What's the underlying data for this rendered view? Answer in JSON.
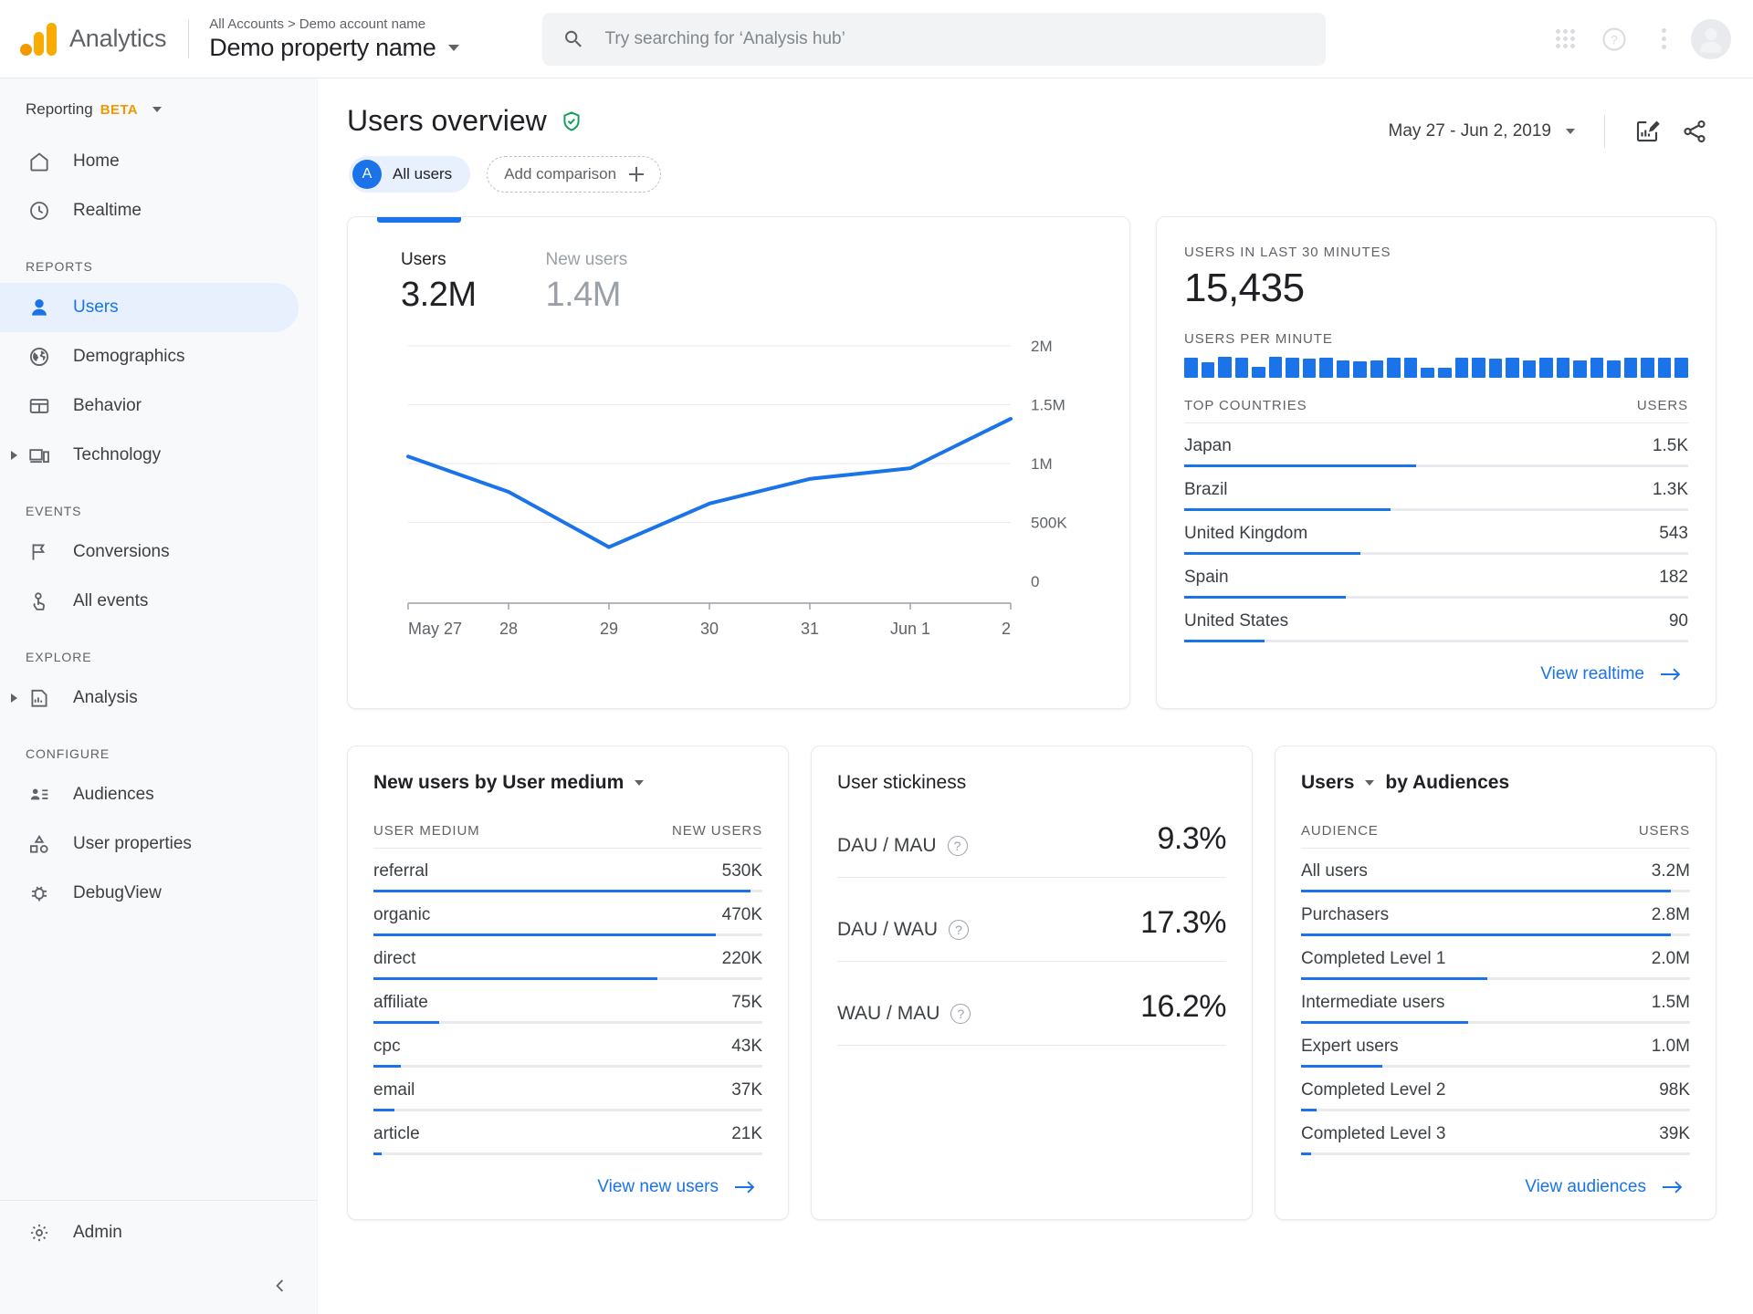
{
  "topbar": {
    "brand_name": "Analytics",
    "breadcrumb_root": "All Accounts",
    "breadcrumb_sep": ">",
    "breadcrumb_account": "Demo account name",
    "property_title": "Demo property name",
    "search_placeholder": "Try searching for ‘Analysis hub’",
    "icons": {
      "search": "search-icon",
      "apps": "apps-grid-icon",
      "help": "help-circle-icon",
      "more": "kebab-menu-icon",
      "avatar": "user-avatar"
    }
  },
  "sidebar": {
    "reporting_label": "Reporting",
    "reporting_beta": "BETA",
    "primary": [
      {
        "label": "Home",
        "icon": "home-icon"
      },
      {
        "label": "Realtime",
        "icon": "clock-icon"
      }
    ],
    "sections": [
      {
        "title": "REPORTS",
        "items": [
          {
            "label": "Users",
            "icon": "person-icon",
            "active": true,
            "expandable": false
          },
          {
            "label": "Demographics",
            "icon": "globe-icon",
            "active": false,
            "expandable": false
          },
          {
            "label": "Behavior",
            "icon": "window-icon",
            "active": false,
            "expandable": false
          },
          {
            "label": "Technology",
            "icon": "devices-icon",
            "active": false,
            "expandable": true
          }
        ]
      },
      {
        "title": "EVENTS",
        "items": [
          {
            "label": "Conversions",
            "icon": "flag-icon",
            "active": false,
            "expandable": false
          },
          {
            "label": "All events",
            "icon": "tap-icon",
            "active": false,
            "expandable": false
          }
        ]
      },
      {
        "title": "EXPLORE",
        "items": [
          {
            "label": "Analysis",
            "icon": "analysis-icon",
            "active": false,
            "expandable": true
          }
        ]
      },
      {
        "title": "CONFIGURE",
        "items": [
          {
            "label": "Audiences",
            "icon": "audiences-icon",
            "active": false,
            "expandable": false
          },
          {
            "label": "User properties",
            "icon": "shapes-icon",
            "active": false,
            "expandable": false
          },
          {
            "label": "DebugView",
            "icon": "bug-icon",
            "active": false,
            "expandable": false
          }
        ]
      }
    ],
    "admin_label": "Admin",
    "admin_icon": "gear-icon",
    "collapse_icon": "chevron-left-icon"
  },
  "page": {
    "title": "Users overview",
    "verified_icon": "shield-check-icon",
    "chip_all_users": {
      "avatar_letter": "A",
      "label": "All users"
    },
    "chip_add_comparison": "Add comparison",
    "date_range": "May 27 - Jun 2, 2019",
    "insights_icon": "insights-edit-icon",
    "share_icon": "share-icon"
  },
  "users_card": {
    "metrics": [
      {
        "label": "Users",
        "value": "3.2M"
      },
      {
        "label": "New users",
        "value": "1.4M"
      }
    ]
  },
  "realtime_card": {
    "last30_label": "USERS IN LAST 30 MINUTES",
    "last30_value": "15,435",
    "per_minute_label": "USERS PER MINUTE",
    "table_head": {
      "dimension": "TOP COUNTRIES",
      "metric": "USERS"
    },
    "rows": [
      {
        "name": "Japan",
        "value": "1.5K",
        "pct": 46
      },
      {
        "name": "Brazil",
        "value": "1.3K",
        "pct": 41
      },
      {
        "name": "United Kingdom",
        "value": "543",
        "pct": 35
      },
      {
        "name": "Spain",
        "value": "182",
        "pct": 32
      },
      {
        "name": "United States",
        "value": "90",
        "pct": 16
      }
    ],
    "link": "View realtime",
    "link_icon": "arrow-right-icon"
  },
  "new_users_card": {
    "title": "New users  by User medium",
    "table_head": {
      "dimension": "USER MEDIUM",
      "metric": "NEW USERS"
    },
    "rows": [
      {
        "name": "referral",
        "value": "530K",
        "pct": 97
      },
      {
        "name": "organic",
        "value": "470K",
        "pct": 88
      },
      {
        "name": "direct",
        "value": "220K",
        "pct": 73
      },
      {
        "name": "affiliate",
        "value": "75K",
        "pct": 17
      },
      {
        "name": "cpc",
        "value": "43K",
        "pct": 7
      },
      {
        "name": "email",
        "value": "37K",
        "pct": 5.5
      },
      {
        "name": "article",
        "value": "21K",
        "pct": 2
      }
    ],
    "link": "View new users",
    "link_icon": "arrow-right-icon"
  },
  "stickiness_card": {
    "title": "User stickiness",
    "rows": [
      {
        "label": "DAU / MAU",
        "value": "9.3%",
        "help_icon": "help-circle-icon"
      },
      {
        "label": "DAU / WAU",
        "value": "17.3%",
        "help_icon": "help-circle-icon"
      },
      {
        "label": "WAU / MAU",
        "value": "16.2%",
        "help_icon": "help-circle-icon"
      }
    ]
  },
  "audiences_card": {
    "title_metric": "Users",
    "title_rest": "by Audiences",
    "table_head": {
      "dimension": "AUDIENCE",
      "metric": "USERS"
    },
    "rows": [
      {
        "name": "All users",
        "value": "3.2M",
        "pct": 95
      },
      {
        "name": "Purchasers",
        "value": "2.8M",
        "pct": 95
      },
      {
        "name": "Completed Level 1",
        "value": "2.0M",
        "pct": 48
      },
      {
        "name": "Intermediate users",
        "value": "1.5M",
        "pct": 43
      },
      {
        "name": "Expert users",
        "value": "1.0M",
        "pct": 21
      },
      {
        "name": "Completed Level 2",
        "value": "98K",
        "pct": 4
      },
      {
        "name": "Completed Level 3",
        "value": "39K",
        "pct": 2.5
      }
    ],
    "link": "View audiences",
    "link_icon": "arrow-right-icon"
  },
  "colors": {
    "accent_blue": "#1a73e8",
    "chip_bg": "#e8f0fe",
    "brand_orange": "#f9ab00",
    "verified_green": "#0f9d58",
    "sidebar_bg": "#f8f9fa",
    "text_primary": "#202124",
    "text_secondary": "#5f6368",
    "divider": "#e8eaed"
  },
  "chart_data": {
    "type": "line",
    "title": "Users",
    "xlabel": "",
    "ylabel": "",
    "categories": [
      "May 27",
      "28",
      "29",
      "30",
      "31",
      "Jun 1",
      "2"
    ],
    "ytick_labels": [
      "0",
      "500K",
      "1M",
      "1.5M",
      "2M"
    ],
    "ytick_values": [
      0,
      500000,
      1000000,
      1500000,
      2000000
    ],
    "ylim": [
      0,
      2000000
    ],
    "grid": true,
    "legend": "none",
    "series": [
      {
        "name": "Users",
        "color": "#1a73e8",
        "values": [
          1060000,
          760000,
          290000,
          660000,
          870000,
          960000,
          1380000
        ]
      }
    ]
  },
  "sparkline_data": {
    "type": "bar",
    "title": "USERS PER MINUTE",
    "values": [
      92,
      72,
      95,
      93,
      48,
      95,
      90,
      88,
      91,
      78,
      77,
      78,
      90,
      92,
      44,
      47,
      92,
      90,
      88,
      92,
      80,
      90,
      92,
      80,
      91,
      80,
      93,
      92,
      90,
      93
    ]
  }
}
